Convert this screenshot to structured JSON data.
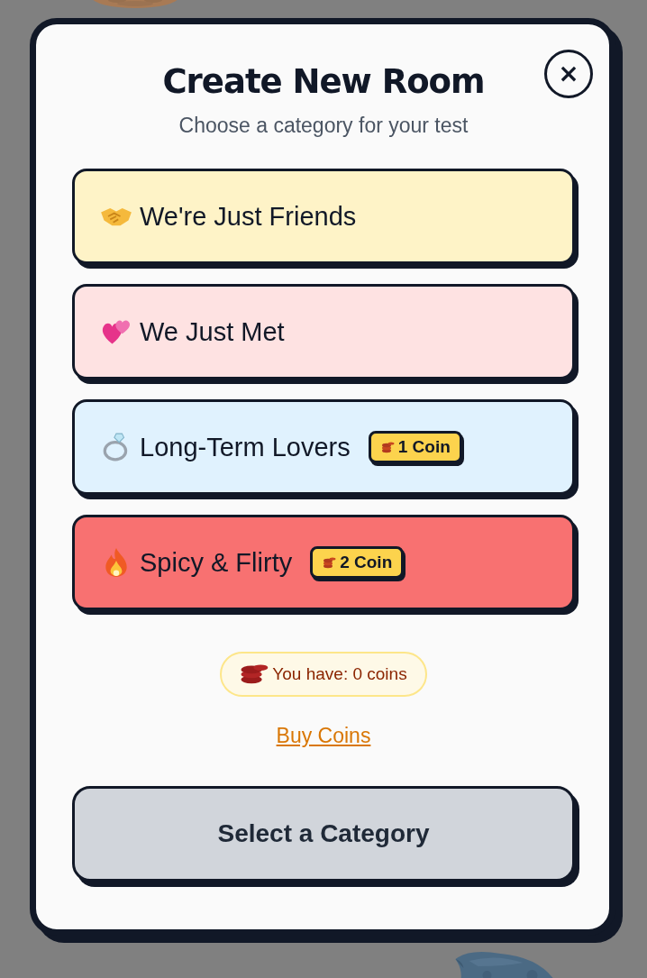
{
  "dialog": {
    "title": "Create New Room",
    "subtitle": "Choose a category for your test",
    "close_label": "×"
  },
  "categories": [
    {
      "kind": "friends",
      "label": "We're Just Friends",
      "color": "#fef3c7",
      "selected": false
    },
    {
      "kind": "met",
      "label": "We Just Met",
      "color": "#fee2e2",
      "selected": false
    },
    {
      "kind": "lovers",
      "label": "Long-Term Lovers",
      "color": "#e0f2fe",
      "selected": false,
      "price": "1 Coin"
    },
    {
      "kind": "spicy",
      "label": "Spicy & Flirty",
      "color": "#f87171",
      "selected": false,
      "price": "2 Coin"
    }
  ],
  "balance": "You have: 0 coins",
  "buy_link": "Buy Coins",
  "submit": {
    "label": "Select a Category",
    "disabled": true
  }
}
